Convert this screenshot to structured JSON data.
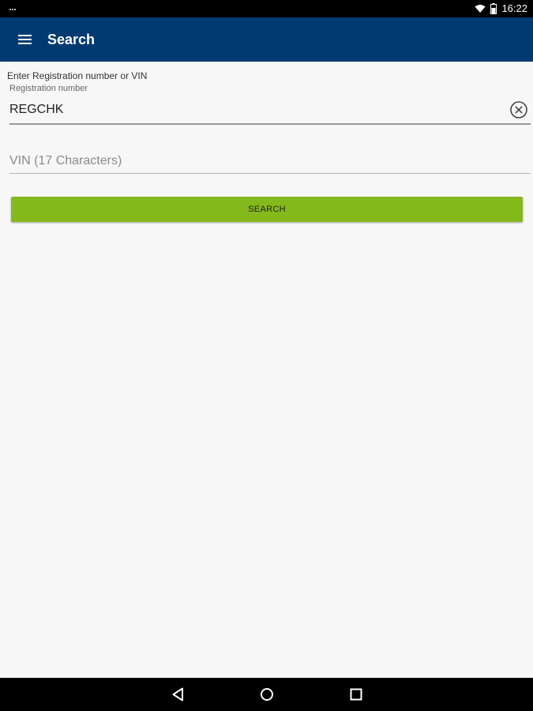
{
  "status_bar": {
    "time": "16:22",
    "icons": [
      "notification-icon",
      "wifi-icon",
      "battery-icon"
    ]
  },
  "app_bar": {
    "title": "Search",
    "menu_icon": "menu-icon",
    "background_color": "#003a70"
  },
  "form": {
    "instruction": "Enter Registration number or VIN",
    "registration": {
      "label": "Registration number",
      "value": "REGCHK",
      "clear_icon": "clear-icon"
    },
    "vin": {
      "placeholder": "VIN (17 Characters)",
      "value": ""
    },
    "search_button": {
      "label": "SEARCH",
      "color": "#84b91c"
    }
  },
  "nav_bar": {
    "icons": [
      "back-icon",
      "home-icon",
      "recents-icon"
    ]
  }
}
